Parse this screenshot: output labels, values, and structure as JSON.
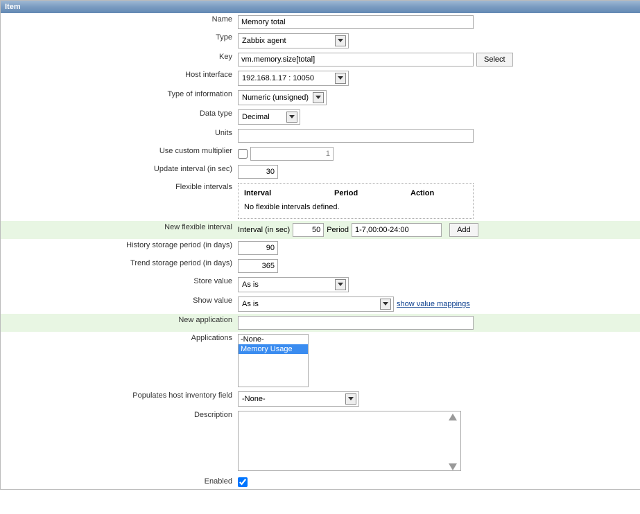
{
  "panel_title": "Item",
  "labels": {
    "name": "Name",
    "type": "Type",
    "key": "Key",
    "host_interface": "Host interface",
    "type_of_information": "Type of information",
    "data_type": "Data type",
    "units": "Units",
    "use_custom_multiplier": "Use custom multiplier",
    "update_interval": "Update interval (in sec)",
    "flexible_intervals": "Flexible intervals",
    "new_flexible_interval": "New flexible interval",
    "history_storage": "History storage period (in days)",
    "trend_storage": "Trend storage period (in days)",
    "store_value": "Store value",
    "show_value": "Show value",
    "new_application": "New application",
    "applications": "Applications",
    "populates_inventory": "Populates host inventory field",
    "description": "Description",
    "enabled": "Enabled"
  },
  "buttons": {
    "select": "Select",
    "add": "Add"
  },
  "links": {
    "show_value_mappings": "show value mappings"
  },
  "flex_headers": {
    "interval": "Interval",
    "period": "Period",
    "action": "Action"
  },
  "flex_no_defined": "No flexible intervals defined.",
  "new_flex": {
    "interval_label": "Interval (in sec)",
    "interval_value": "50",
    "period_label": "Period",
    "period_value": "1-7,00:00-24:00"
  },
  "values": {
    "name": "Memory total",
    "type": "Zabbix agent",
    "key": "vm.memory.size[total]",
    "host_interface": "192.168.1.17 : 10050",
    "type_of_information": "Numeric (unsigned)",
    "data_type": "Decimal",
    "units": "",
    "use_custom_multiplier_checked": false,
    "multiplier": "1",
    "update_interval": "30",
    "history_storage": "90",
    "trend_storage": "365",
    "store_value": "As is",
    "show_value": "As is",
    "new_application": "",
    "applications": [
      "-None-",
      "Memory Usage"
    ],
    "applications_selected": "Memory Usage",
    "populates_inventory": "-None-",
    "description": "",
    "enabled_checked": true
  }
}
